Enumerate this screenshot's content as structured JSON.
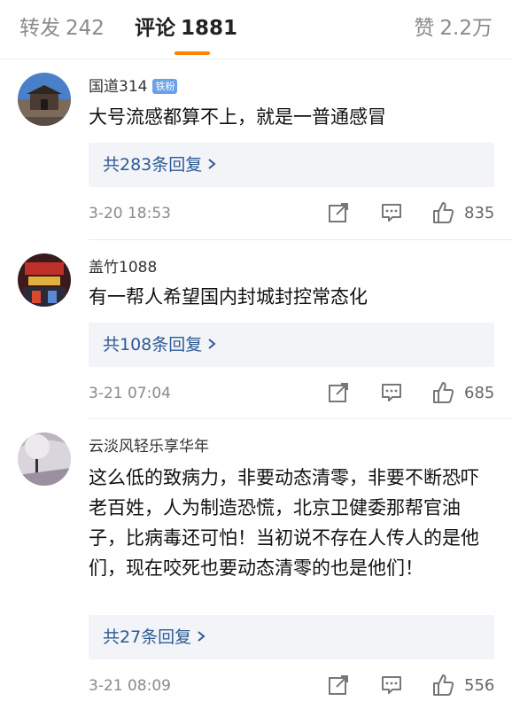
{
  "tabs": {
    "repost": {
      "label": "转发",
      "count": "242"
    },
    "comments": {
      "label": "评论",
      "count": "1881"
    },
    "likes": {
      "label": "赞",
      "count": "2.2万"
    }
  },
  "accent_color": "#ff8200",
  "link_color": "#2e5a96",
  "icons": [
    "share-icon",
    "reply-icon",
    "thumbs-up-icon",
    "chevron-right-icon"
  ],
  "comments": [
    {
      "username": "国道314",
      "badge": "铁粉",
      "content": "大号流感都算不上，就是一普通感冒",
      "replies": "共283条回复",
      "time": "3-20 18:53",
      "likes": "835"
    },
    {
      "username": "盖竹1088",
      "content": "有一帮人希望国内封城封控常态化",
      "replies": "共108条回复",
      "time": "3-21 07:04",
      "likes": "685"
    },
    {
      "username": "云淡风轻乐享华年",
      "content": "这么低的致病力，非要动态清零，非要不断恐吓老百姓，人为制造恐慌，北京卫健委那帮官油子，比病毒还可怕！当初说不存在人传人的是他们，现在咬死也要动态清零的也是他们！",
      "replies": "共27条回复",
      "time": "3-21 08:09",
      "likes": "556"
    }
  ]
}
